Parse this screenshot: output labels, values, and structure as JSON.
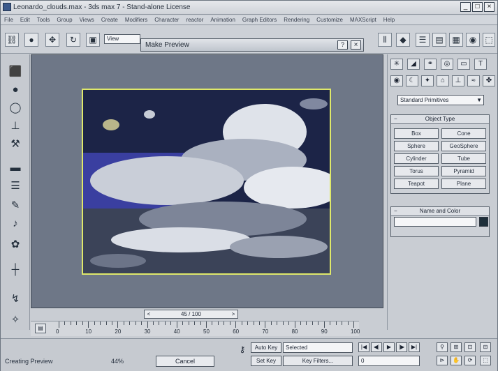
{
  "window": {
    "title": "Leonardo_clouds.max - 3ds max 7 - Stand-alone License",
    "minimize": "_",
    "maximize": "□",
    "close": "×"
  },
  "menu": [
    "File",
    "Edit",
    "Tools",
    "Group",
    "Views",
    "Create",
    "Modifiers",
    "Character",
    "reactor",
    "Animation",
    "Graph Editors",
    "Rendering",
    "Customize",
    "MAXScript",
    "Help"
  ],
  "toolbar": {
    "view_select": "View"
  },
  "dialog": {
    "title": "Make Preview",
    "help": "?",
    "close": "×"
  },
  "viewport": {
    "label": "",
    "frame_counter": "45 / 100"
  },
  "command_panel": {
    "primitive_select": "Standard Primitives",
    "object_type": {
      "title": "Object Type",
      "buttons": [
        "Box",
        "Cone",
        "Sphere",
        "GeoSphere",
        "Cylinder",
        "Tube",
        "Torus",
        "Pyramid",
        "Teapot",
        "Plane"
      ]
    },
    "name_and_color": {
      "title": "Name and Color",
      "swatch_color": "#1e2f3a"
    }
  },
  "timeline": {
    "ticks": [
      "0",
      "10",
      "20",
      "30",
      "40",
      "50",
      "60",
      "70",
      "80",
      "90",
      "100"
    ]
  },
  "status": {
    "left_text": "Creating Preview",
    "percent": "44%",
    "cancel_label": "Cancel",
    "auto_key": "Auto Key",
    "selected": "Selected",
    "set_key": "Set Key",
    "key_filters": "Key Filters...",
    "frame_field": "0"
  }
}
